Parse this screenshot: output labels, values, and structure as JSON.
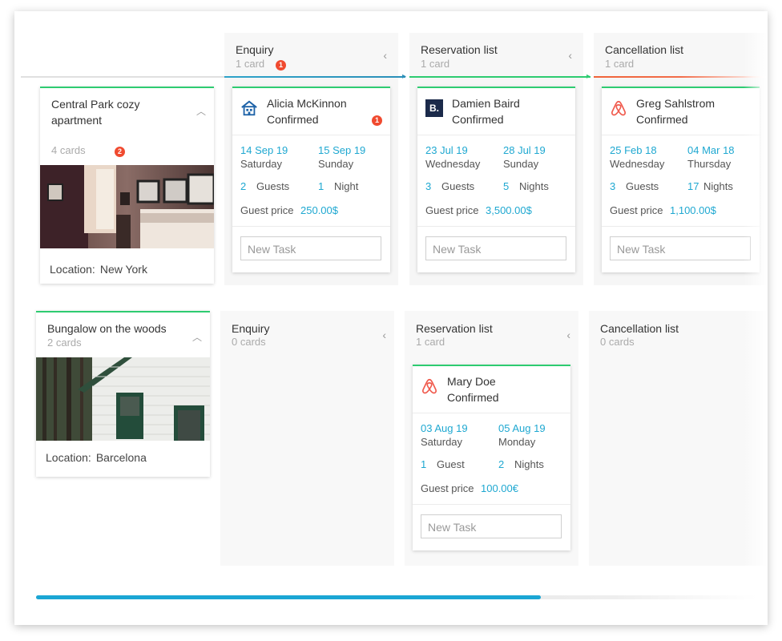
{
  "boards": [
    {
      "property": {
        "title_line1": "Central Park cozy",
        "title_line2": "apartment",
        "cards": "4 cards",
        "badge": "2",
        "location_label": "Location:",
        "location": "New York"
      },
      "columns": [
        {
          "title": "Enquiry",
          "count": "1 card",
          "badge": "1"
        },
        {
          "title": "Reservation list",
          "count": "1 card"
        },
        {
          "title": "Cancellation list",
          "count": "1 card"
        }
      ],
      "cards": [
        {
          "guest": "Alicia McKinnon",
          "status": "Confirmed",
          "badge": "1",
          "source_icon": "house-icon",
          "check_in": "14 Sep 19",
          "check_in_day": "Saturday",
          "check_out": "15 Sep 19",
          "check_out_day": "Sunday",
          "guests_num": "2",
          "guests_label": "Guests",
          "nights_num": "1",
          "nights_label": "Night",
          "price_label": "Guest price",
          "price": "250.00$",
          "task_placeholder": "New Task"
        },
        {
          "guest": "Damien Baird",
          "status": "Confirmed",
          "source_icon": "booking-b-icon",
          "logo_text": "B.",
          "check_in": "23 Jul 19",
          "check_in_day": "Wednesday",
          "check_out": "28 Jul 19",
          "check_out_day": "Sunday",
          "guests_num": "3",
          "guests_label": "Guests",
          "nights_num": "5",
          "nights_label": "Nights",
          "price_label": "Guest price",
          "price": "3,500.00$",
          "task_placeholder": "New Task"
        },
        {
          "guest": "Greg Sahlstrom",
          "status": "Confirmed",
          "source_icon": "airbnb-icon",
          "check_in": "25 Feb 18",
          "check_in_day": "Wednesday",
          "check_out": "04 Mar 18",
          "check_out_day": "Thursday",
          "guests_num": "3",
          "guests_label": "Guests",
          "nights_num": "17",
          "nights_label": "Nights",
          "price_label": "Guest price",
          "price": "1,100.00$",
          "task_placeholder": "New Task"
        }
      ]
    },
    {
      "property": {
        "title": "Bungalow on the woods",
        "cards": "2 cards",
        "location_label": "Location:",
        "location": "Barcelona"
      },
      "columns": [
        {
          "title": "Enquiry",
          "count": "0 cards"
        },
        {
          "title": "Reservation list",
          "count": "1 card"
        },
        {
          "title": "Cancellation list",
          "count": "0 cards"
        }
      ],
      "cards": [
        {
          "guest": "Mary Doe",
          "status": "Confirmed",
          "source_icon": "airbnb-icon",
          "check_in": "03 Aug 19",
          "check_in_day": "Saturday",
          "check_out": "05 Aug 19",
          "check_out_day": "Monday",
          "guests_num": "1",
          "guests_label": "Guest",
          "nights_num": "2",
          "nights_label": "Nights",
          "price_label": "Guest price",
          "price": "100.00€",
          "task_placeholder": "New Task"
        }
      ]
    }
  ],
  "scroll_progress": 0.7,
  "colors": {
    "accent": "#1fa8d1",
    "green": "#2ecc71",
    "badge": "#f04a2f",
    "cancel": "#f0643a"
  }
}
